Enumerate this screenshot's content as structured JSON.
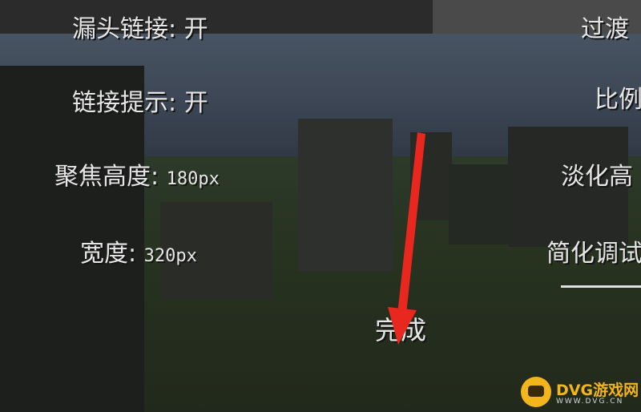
{
  "settings": {
    "top_left_clipped": "漏头链接: 开",
    "top_right_clipped": "过渡",
    "link_hint_label": "链接提示: 开",
    "focus_height_label": "聚焦高度: ",
    "focus_height_value": "180px",
    "width_label": "宽度: ",
    "width_value": "320px",
    "right_ratio_clipped": "比例",
    "right_fade_clipped": "淡化高",
    "right_simplify_clipped": "简化调试"
  },
  "done_button": {
    "label": "完成"
  },
  "watermark": {
    "brand": "DVG游戏网",
    "sub": "WWW.DVG.CN"
  },
  "colors": {
    "annotation_arrow": "#e8281e",
    "logo_accent": "#f2b51b",
    "text": "#e6e6e6"
  },
  "icons": {
    "logo": "game-controller-icon",
    "arrow": "red-arrow-annotation"
  }
}
